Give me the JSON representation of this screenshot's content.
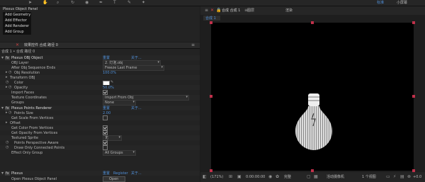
{
  "left_panel": {
    "title": "Plexus Object Panel",
    "menu": [
      "Add Geometry",
      "Add Effector",
      "Add Renderer",
      "Add Group"
    ]
  },
  "effect_controls": {
    "tab_label": "效果控件 合成 路径 0",
    "breadcrumb": "合成 1 • 合成 路径 0",
    "rows": [
      {
        "label": "Plexus OBJ Object",
        "c1": "重置",
        "c2": "关于..."
      },
      {
        "label": "OBJ Layer",
        "value": "2. 灯泡.obj"
      },
      {
        "label": "After Obj Sequence Ends",
        "value": "Freeze Last Frame"
      },
      {
        "label": "Obj Resolution",
        "value": "100.0%"
      },
      {
        "label": "Transform OBJ"
      },
      {
        "label": "Color"
      },
      {
        "label": "Opacity",
        "value": "50.0%"
      },
      {
        "label": "Import Faces"
      },
      {
        "label": "Texture Coordinates",
        "value": "Import From Obj"
      },
      {
        "label": "Groups",
        "value": "None"
      },
      {
        "label": "Plexus Points Renderer",
        "c1": "重置",
        "c2": "关于..."
      },
      {
        "label": "Points Size",
        "value": "2.00"
      },
      {
        "label": "Get Scale From Vertices"
      },
      {
        "label": "Offset"
      },
      {
        "label": "Get Color From Vertices"
      },
      {
        "label": "Get Opacity From Vertices"
      },
      {
        "label": "Textured Sprite",
        "value": "无"
      },
      {
        "label": "Points Perspective Aware"
      },
      {
        "label": "Draw Only Connected Points"
      },
      {
        "label": "Effect Only Group",
        "value": "All Groups"
      },
      {
        "label": "Plexus",
        "c1": "重置",
        "c2": "Register",
        "c3": "关于..."
      },
      {
        "label": "Open Plexus Object Panel",
        "value": "Open"
      }
    ]
  },
  "comp_panel": {
    "tab_label": "合成 合成 1",
    "sub_tab": "合成 1",
    "menu_a": "图层",
    "menu_b": "渲染",
    "menu_c": "标准",
    "menu_d": "小屏幕",
    "zoom": "(171%)",
    "timecode": "0:00:00:00",
    "quality": "完整",
    "camera": "活动摄像机",
    "views": "1 个视图",
    "exposure": "+0.0"
  },
  "colors": {
    "accent_blue": "#4f8fd8",
    "marker_red": "#c0304a"
  }
}
